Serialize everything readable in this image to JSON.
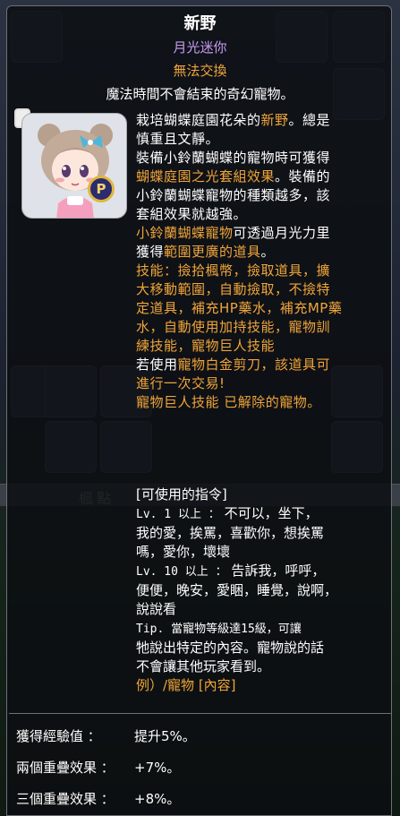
{
  "pet": {
    "name": "新野",
    "series": "月光迷你",
    "trade": "無法交換",
    "tagline": "魔法時間不會結束的奇幻寵物。",
    "badge": "P",
    "description_lines": [
      [
        {
          "t": "栽培蝴蝶庭園花朵的"
        },
        {
          "t": "新野",
          "o": true
        },
        {
          "t": "。總是"
        }
      ],
      [
        {
          "t": "慎重且文靜。"
        }
      ],
      [
        {
          "t": "裝備小鈴蘭蝴蝶的寵物時可獲得"
        }
      ],
      [
        {
          "t": "蝴蝶庭園之光套組效果",
          "o": true
        },
        {
          "t": "。裝備的"
        }
      ],
      [
        {
          "t": "小鈴蘭蝴蝶寵物的種類越多，該"
        }
      ],
      [
        {
          "t": "套組效果就越強。"
        }
      ],
      [
        {
          "t": "小鈴蘭蝴蝶寵物",
          "o": true
        },
        {
          "t": "可透過月光力里"
        }
      ],
      [
        {
          "t": "獲得"
        },
        {
          "t": "範圍更廣的道具",
          "o": true
        },
        {
          "t": "。"
        }
      ],
      [
        {
          "t": "技能：撿拾楓幣，撿取道具，擴",
          "o": true
        }
      ],
      [
        {
          "t": "大移動範圍，自動撿取，不撿特",
          "o": true
        }
      ],
      [
        {
          "t": "定道具，補充HP藥水，補充MP藥",
          "o": true
        }
      ],
      [
        {
          "t": "水，自動使用加持技能，寵物訓",
          "o": true
        }
      ],
      [
        {
          "t": "練技能，寵物巨人技能",
          "o": true
        }
      ],
      [
        {
          "t": "若使用"
        },
        {
          "t": "寵物白金剪刀，該道具可",
          "o": true
        }
      ],
      [
        {
          "t": "進行一次交易!",
          "o": true
        }
      ],
      [
        {
          "t": "寵物巨人技能 已解除的寵物。",
          "o": true
        }
      ]
    ],
    "command_lines": [
      [
        {
          "t": "[可使用的指令]"
        }
      ],
      [
        {
          "t": "Lv. 1 以上 ：",
          "m": true
        },
        {
          "t": " 不可以，坐下，"
        }
      ],
      [
        {
          "t": "我的愛，挨罵，喜歡你，想挨罵"
        }
      ],
      [
        {
          "t": "嗎，愛你，壞壞"
        }
      ],
      [
        {
          "t": "Lv. 10 以上 ：",
          "m": true
        },
        {
          "t": " 告訴我，呼呼，"
        }
      ],
      [
        {
          "t": "便便，晚安，愛睏，睡覺，說啊，"
        }
      ],
      [
        {
          "t": "說說看"
        }
      ],
      [
        {
          "t": "Tip. 當寵物等級達15級，可讓",
          "m": true
        }
      ],
      [
        {
          "t": "牠說出特定的內容。寵物說的話"
        }
      ],
      [
        {
          "t": "不會讓其他玩家看到。"
        }
      ],
      [
        {
          "t": "例）/寵物 [內容]",
          "o": true
        }
      ]
    ]
  },
  "stats": [
    {
      "label": "獲得經驗值 ：",
      "value": "提升5%。"
    },
    {
      "label": "兩個重疊效果 ：",
      "value": "+7%。"
    },
    {
      "label": "三個重疊效果 ：",
      "value": "+8%。"
    }
  ],
  "background": {
    "bar_label": "楓點"
  }
}
